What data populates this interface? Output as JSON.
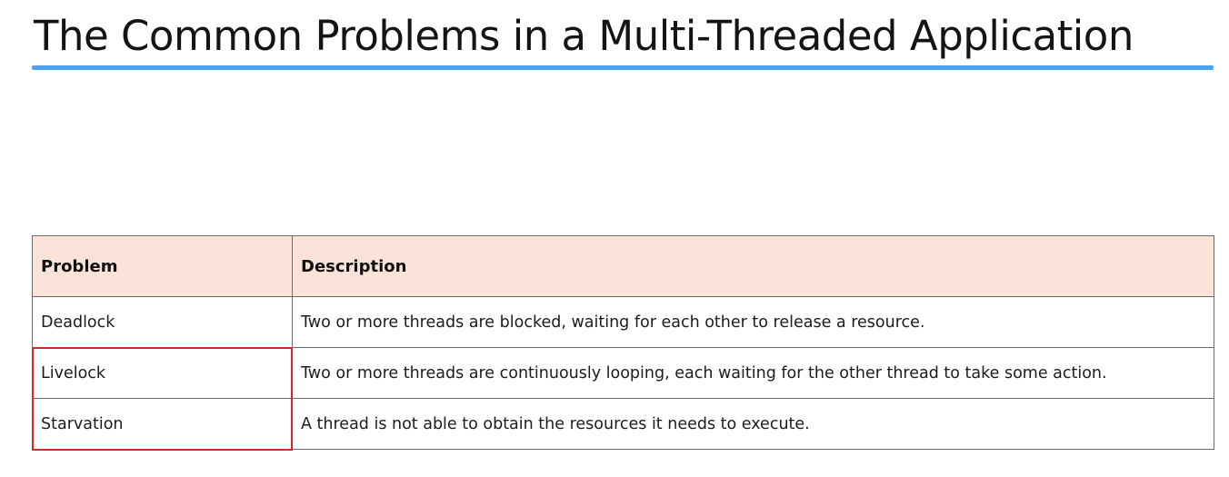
{
  "slide": {
    "title": "The Common Problems in a Multi-Threaded Application"
  },
  "colors": {
    "title_rule": "#4da3ea",
    "header_background": "#fbe3d9",
    "highlight_border": "#d9262c"
  },
  "table": {
    "headers": {
      "problem": "Problem",
      "description": "Description"
    },
    "rows": [
      {
        "problem": "Deadlock",
        "description": "Two or more threads are blocked, waiting for each other to release a resource."
      },
      {
        "problem": "Livelock",
        "description": "Two or more threads are continuously looping, each waiting for the other thread to take some action."
      },
      {
        "problem": "Starvation",
        "description": "A thread is not able to obtain the resources it needs to execute."
      }
    ],
    "highlighted_problems": [
      "Livelock",
      "Starvation"
    ]
  }
}
